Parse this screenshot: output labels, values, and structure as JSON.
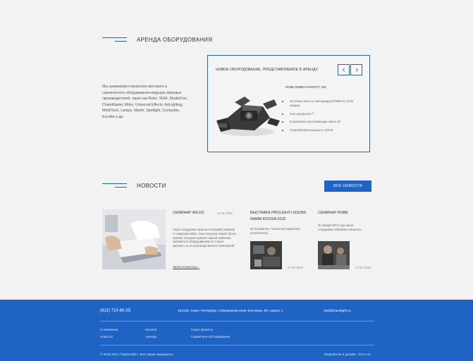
{
  "rental": {
    "title": "АРЕНДА ОБОРУДОВАНИЯ",
    "about": "Мы занимаемся прокатом светового и сценического оборудования ведущих мировых производителей, таких как Robe, SGM, StudioDue, ChainMaster, Milos, Universal Effects, ArtLighting, MobilTech, Lampo, Martin, Spotlight, Compulite, Eurolite и др.",
    "box_heading": "НОВОЕ ОБОРУДОВАНИЕ, ПРЕДСТАВЛЯЕМОЕ В АРЕНДУ:",
    "product": {
      "name": "ROBE ROBIN PARFECT 100",
      "specs": [
        "Источник света 12 светодиодов RGBW по 15 Вт каждый",
        "Угол раскрытия 7°",
        "В комплекте рассеивающая линза 40°",
        "Потребляемая мощность 200 Вт"
      ]
    },
    "prev_icon": "chevron-left-icon",
    "next_icon": "chevron-right-icon"
  },
  "news": {
    "title": "НОВОСТИ",
    "all_label": "ВСЕ НОВОСТИ",
    "items": [
      {
        "title": "СЕМИНАР MILOS",
        "date": "27.01.2016",
        "text": "Наши сотрудники прошли последний семинар от компании Milos. Они получили новый объем знаний, который позволит нашей компании заниматься оборудованием не только верхнего, но и производственных помещений.",
        "more": "Читать полностью..."
      },
      {
        "title": "ВЫСТАВКА PROLIGHT+SOUND NAMM RUSSIA 2016",
        "date": "27.01.2016",
        "text": "30 контрактов, тысячи восторженных посетителей..."
      },
      {
        "title": "СЕМИНАР ROBE",
        "date": "27.01.2016",
        "text": "30 января 2017 года наши сотрудники побывали в Вергиле."
      }
    ]
  },
  "footer": {
    "phone": "(812) 710-80-25",
    "address": "191180, Санкт-Петербург, Набережная реки Фонтанки, 90, корпус 1",
    "email": "mail@translight.ru",
    "links": [
      "О компании",
      "Каталог",
      "Наши проекты",
      "Новости",
      "Аренда",
      "Сервисное обслуживание"
    ],
    "copyright": "© 2016 ЗАО «Транслайт». Все права защищены.",
    "dev": "Разработка и дизайн - D-e-n.ru"
  },
  "colors": {
    "accent": "#1f63c4",
    "background": "#f2f2f2"
  }
}
